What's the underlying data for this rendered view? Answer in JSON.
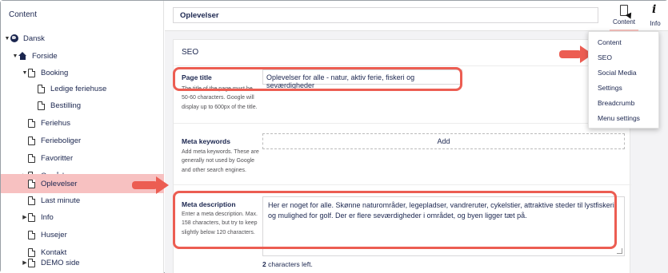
{
  "sidebar": {
    "header": "Content",
    "items": [
      {
        "label": "Dansk",
        "icon": "globe-icon"
      },
      {
        "label": "Forside",
        "icon": "home-icon"
      },
      {
        "label": "Booking",
        "icon": "document-icon"
      },
      {
        "label": "Ledige feriehuse",
        "icon": "document-icon"
      },
      {
        "label": "Bestilling",
        "icon": "document-icon"
      },
      {
        "label": "Feriehus",
        "icon": "document-icon"
      },
      {
        "label": "Ferieboliger",
        "icon": "document-icon"
      },
      {
        "label": "Favoritter",
        "icon": "document-icon"
      },
      {
        "label": "Områder",
        "icon": "document-icon"
      },
      {
        "label": "Oplevelser",
        "icon": "document-icon"
      },
      {
        "label": "Last minute",
        "icon": "document-icon"
      },
      {
        "label": "Info",
        "icon": "document-icon"
      },
      {
        "label": "Husejer",
        "icon": "document-icon"
      },
      {
        "label": "Kontakt",
        "icon": "document-icon"
      },
      {
        "label": "DEMO side",
        "icon": "document-icon"
      }
    ]
  },
  "topbar": {
    "node_name": "Oplevelser",
    "content_label": "Content",
    "info_label": "Info"
  },
  "dropdown": {
    "items": [
      "Content",
      "SEO",
      "Social Media",
      "Settings",
      "Breadcrumb",
      "Menu settings"
    ]
  },
  "seo": {
    "title": "SEO",
    "page_title": {
      "label": "Page title",
      "description": "The title of the page must be 50-60 characters. Google will display up to 600px of the title.",
      "value": "Oplevelser for alle - natur, aktiv ferie, fiskeri og seværdigheder"
    },
    "meta_keywords": {
      "label": "Meta keywords",
      "description": "Add meta keywords. These are generally not used by Google and other search engines.",
      "add_label": "Add"
    },
    "meta_description": {
      "label": "Meta description",
      "description": "Enter a meta description. Max. 158 characters, but try to keep slightly below 120 characters.",
      "value": "Her er noget for alle. Skønne naturområder, legepladser, vandreruter, cykelstier, attraktive steder til lystfiskeri og mulighed for golf. Der er flere seværdigheder i området, og byen ligger tæt på.",
      "chars_left_count": "2",
      "chars_left_text": "characters left."
    }
  },
  "colors": {
    "highlight": "#ec5d52",
    "active_bg": "#f7c1c1",
    "text": "#1b264f"
  }
}
